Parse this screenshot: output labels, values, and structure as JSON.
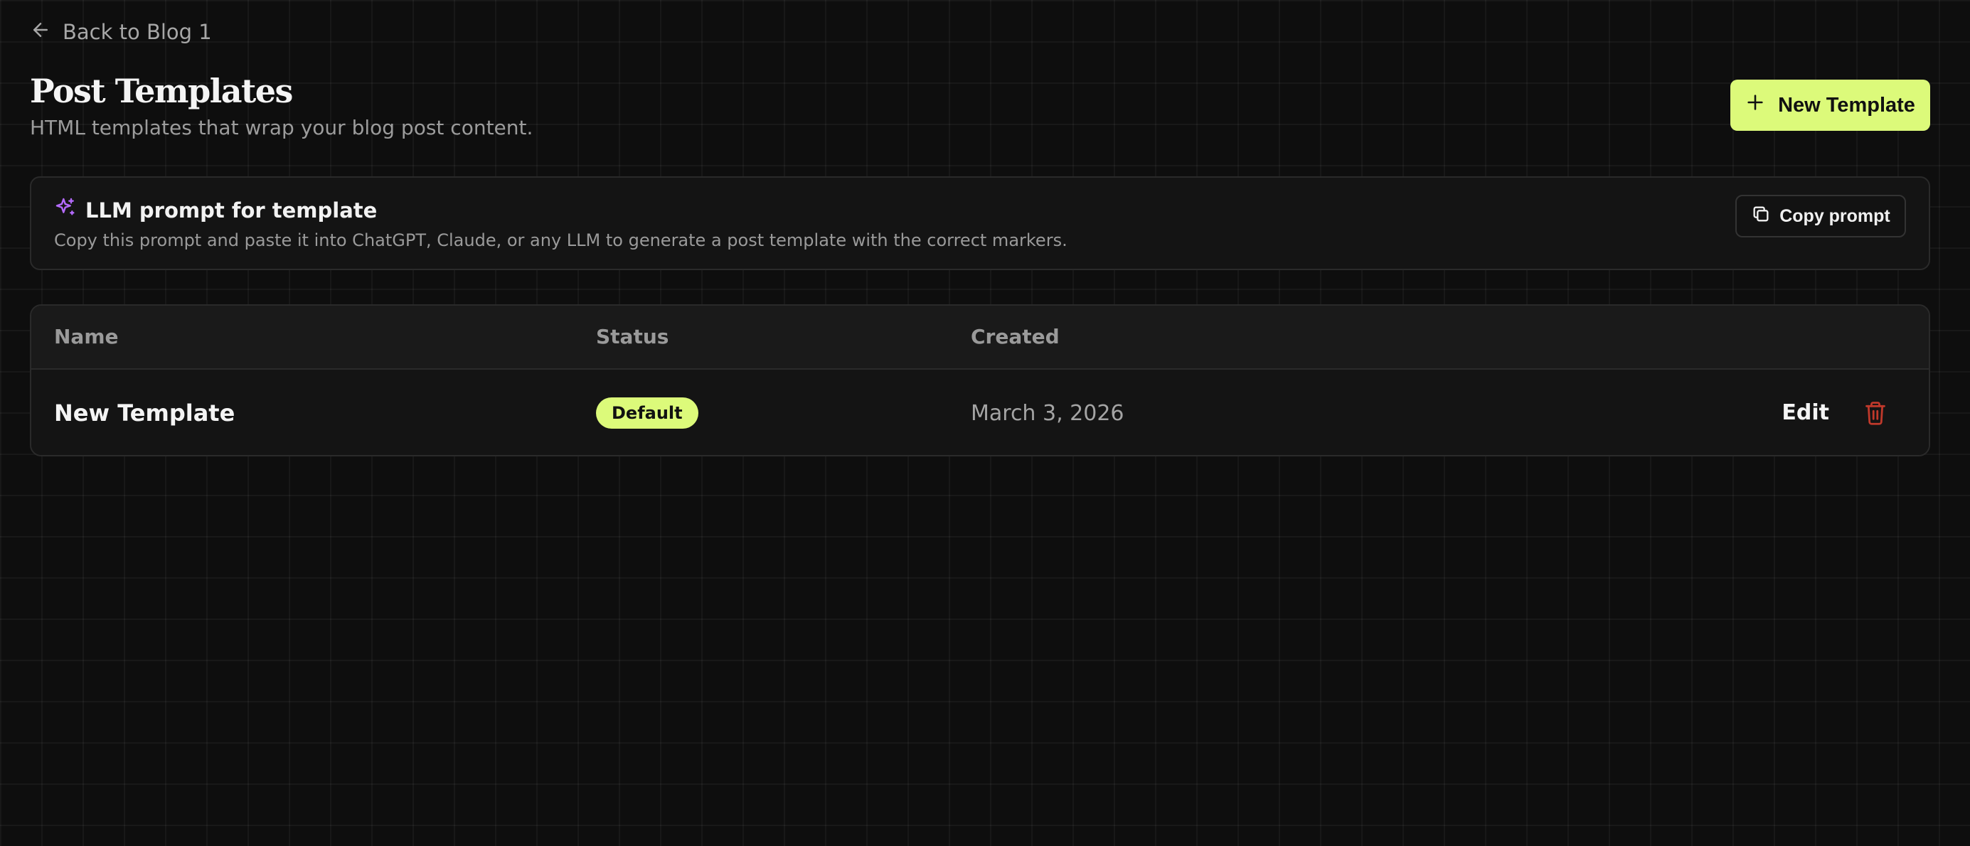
{
  "nav": {
    "back_label": "Back to Blog 1"
  },
  "header": {
    "title": "Post Templates",
    "subtitle": "HTML templates that wrap your blog post content.",
    "new_button_label": "New Template"
  },
  "prompt_card": {
    "title": "LLM prompt for template",
    "description": "Copy this prompt and paste it into ChatGPT, Claude, or any LLM to generate a post template with the correct markers.",
    "copy_button_label": "Copy prompt"
  },
  "table": {
    "columns": [
      "Name",
      "Status",
      "Created"
    ],
    "rows": [
      {
        "name": "New Template",
        "status": "Default",
        "created": "March 3, 2026",
        "edit_label": "Edit"
      }
    ]
  },
  "colors": {
    "accent": "#dcfa7a",
    "sparkle": "#b56bff",
    "danger": "#c0392b",
    "background": "#0e0e0e"
  },
  "icons": {
    "back": "arrow-left-icon",
    "new": "plus-icon",
    "prompt": "sparkles-icon",
    "copy": "copy-icon",
    "delete": "trash-icon"
  }
}
